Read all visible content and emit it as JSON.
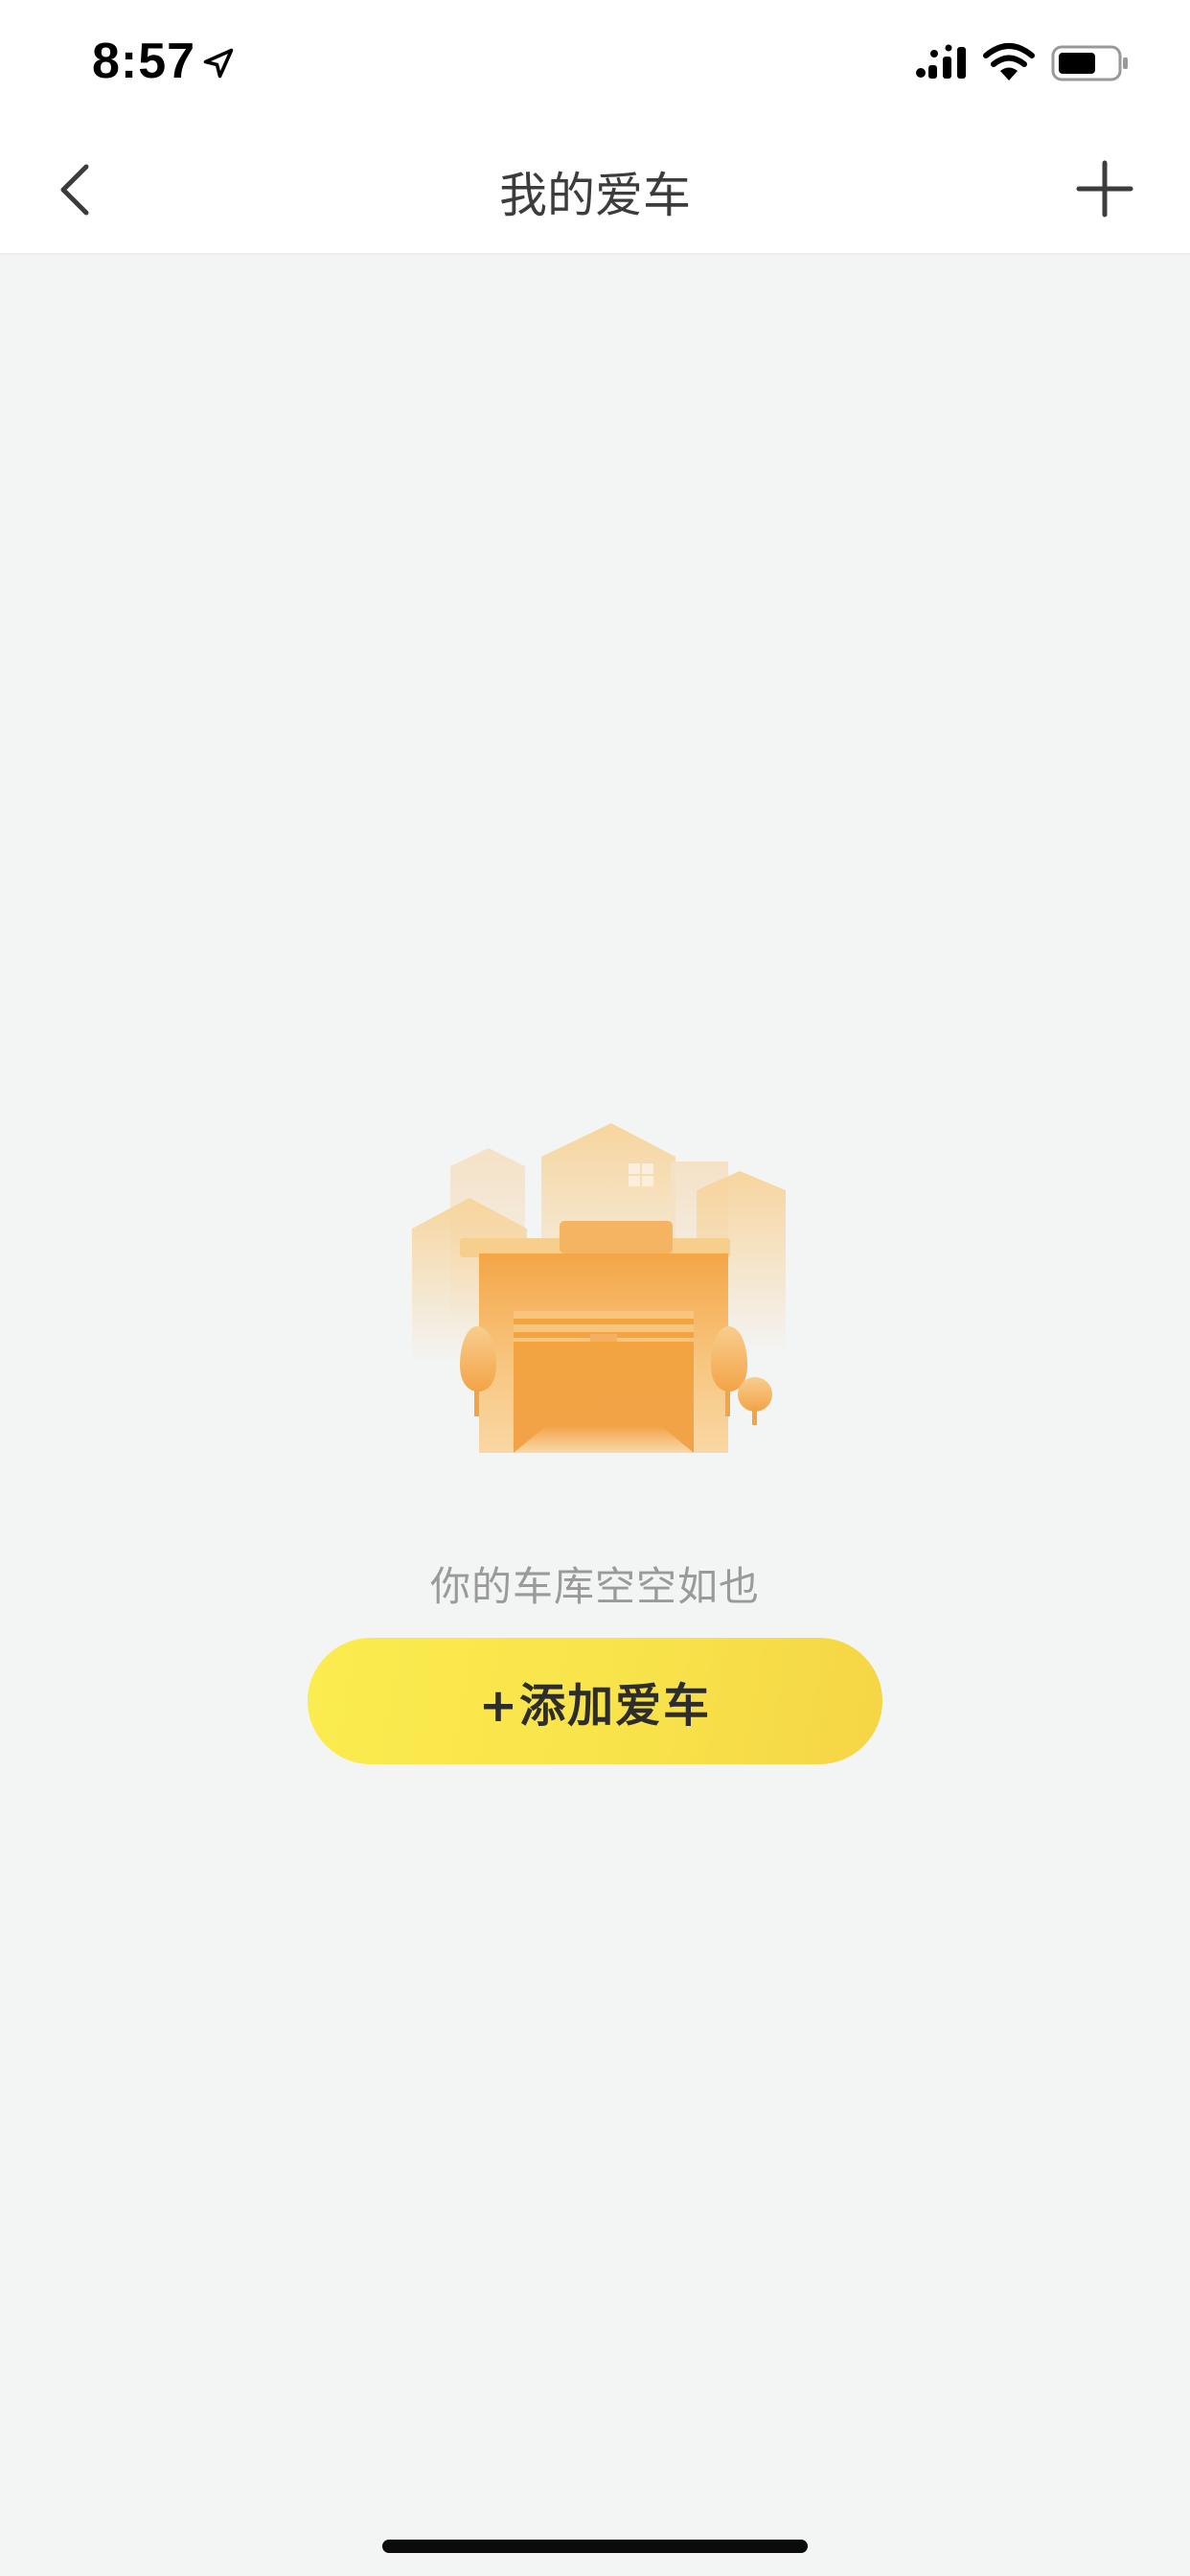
{
  "status_bar": {
    "time": "8:57",
    "icons": [
      "location-arrow-icon",
      "signal-icon",
      "wifi-icon",
      "battery-icon"
    ]
  },
  "nav": {
    "title": "我的爱车",
    "back_icon": "chevron-left-icon",
    "add_icon": "plus-icon"
  },
  "empty_state": {
    "illustration": "garage-illustration",
    "message": "你的车库空空如也",
    "button_label": "+添加爱车"
  },
  "colors": {
    "background": "#f3f4f4",
    "button_gradient_start": "#fbec4f",
    "button_gradient_end": "#f5d546",
    "illustration_orange": "#f3a646"
  }
}
